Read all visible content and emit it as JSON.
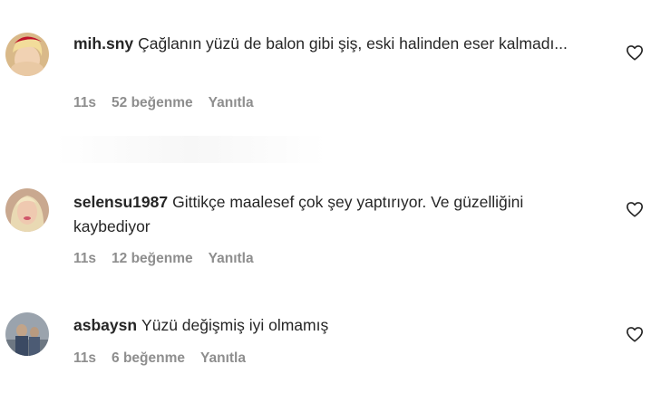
{
  "comments": [
    {
      "username": "mih.sny",
      "text": "Çağlanın yüzü de balon gibi şiş, eski halinden eser kalmadı...",
      "time": "11s",
      "likes": "52 beğenme",
      "reply": "Yanıtla"
    },
    {
      "username": "selensu1987",
      "text": "Gittikçe maalesef çok şey yaptırıyor. Ve güzelliğini kaybediyor",
      "time": "11s",
      "likes": "12 beğenme",
      "reply": "Yanıtla"
    },
    {
      "username": "asbaysn",
      "text": "Yüzü değişmiş iyi olmamış",
      "time": "11s",
      "likes": "6 beğenme",
      "reply": "Yanıtla"
    }
  ],
  "icons": {
    "like": "heart-outline-icon"
  }
}
